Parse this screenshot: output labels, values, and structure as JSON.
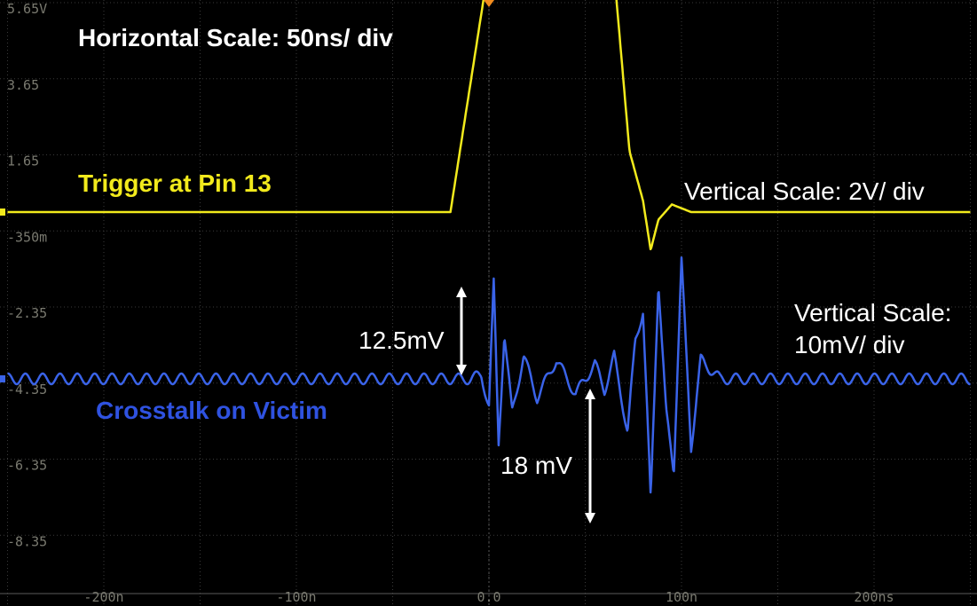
{
  "annotations": {
    "horizontal_scale": "Horizontal Scale: 50ns/ div",
    "trigger_label": "Trigger at Pin 13",
    "vertical_scale_ch1": "Vertical Scale: 2V/ div",
    "vertical_scale_ch2_line1": "Vertical Scale:",
    "vertical_scale_ch2_line2": "10mV/ div",
    "crosstalk_label": "Crosstalk on Victim",
    "measure_peak": "12.5mV",
    "measure_pp": "18 mV"
  },
  "colors": {
    "background": "#000000",
    "grid": "#3a3a3a",
    "ch1": "#f2ea1c",
    "ch2": "#3a63e8",
    "crosstalk_label": "#2f52e0",
    "annotation": "#ffffff",
    "trigger_marker": "#f28c1e",
    "axis_text": "#7a7a70"
  },
  "chart_data": {
    "type": "line",
    "title": "",
    "x_unit": "s",
    "xlim": [
      -2.5e-07,
      2.5e-07
    ],
    "x_tick_labels": [
      "-200n",
      "-100n",
      "0.0",
      "100n",
      "200ns"
    ],
    "x_tick_values": [
      -2e-07,
      -1e-07,
      0,
      1e-07,
      2e-07
    ],
    "y_tick_labels": [
      "5.65V",
      "3.65",
      "1.65",
      "-350m",
      "-2.35",
      "-4.35",
      "-6.35",
      "-8.35"
    ],
    "grid": true,
    "series": [
      {
        "name": "Trigger at Pin 13",
        "channel": "yellow",
        "vertical_scale": "2V/ div",
        "offset_div": 3.35,
        "x": [
          -2.5e-07,
          -2e-08,
          0,
          1e-08,
          3e-08,
          6e-08,
          6.5e-08,
          7.3e-08,
          8e-08,
          8.4e-08,
          8.8e-08,
          9.5e-08,
          1.05e-07,
          2.5e-07
        ],
        "y": [
          0,
          0,
          6.5,
          6.9,
          7.1,
          7.1,
          6.3,
          1.6,
          0.3,
          -1.0,
          -0.2,
          0.2,
          0,
          0
        ]
      },
      {
        "name": "Crosstalk on Victim",
        "channel": "blue",
        "vertical_scale": "10mV/ div",
        "offset_div": 0.0,
        "x": [
          -2.5e-07,
          -1e-08,
          -4e-09,
          0,
          2.5e-09,
          5e-09,
          8e-09,
          1.2e-08,
          1.8e-08,
          2.5e-08,
          3.5e-08,
          4.5e-08,
          5.5e-08,
          6e-08,
          6.5e-08,
          7.2e-08,
          7.6e-08,
          8e-08,
          8.4e-08,
          8.8e-08,
          9.2e-08,
          9.6e-08,
          1e-07,
          1.05e-07,
          1.1e-07,
          1.2e-07,
          2.5e-07
        ],
        "y": [
          0,
          0,
          0.5,
          -3.5,
          12.5,
          -8.5,
          6,
          -4.5,
          3,
          -2.5,
          2.5,
          -2,
          2,
          -1.5,
          3,
          -7,
          5,
          9,
          -16,
          13,
          -4.5,
          -12,
          15.5,
          -9,
          2.5,
          0,
          0
        ]
      }
    ]
  }
}
